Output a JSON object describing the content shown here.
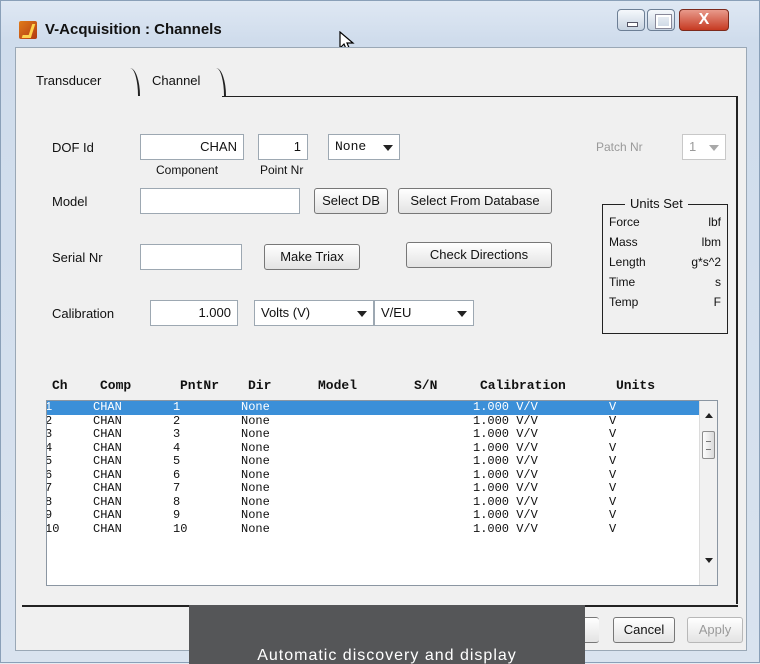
{
  "window": {
    "title": "V-Acquisition : Channels",
    "close_glyph": "X"
  },
  "tabs": [
    {
      "label": "Transducer"
    },
    {
      "label": "Channel"
    }
  ],
  "form": {
    "dof_id_label": "DOF Id",
    "component_value": "CHAN",
    "component_caption": "Component",
    "point_nr_value": "1",
    "point_nr_caption": "Point Nr",
    "direction_value": "None",
    "patch_nr_label": "Patch Nr",
    "patch_nr_value": "1",
    "model_label": "Model",
    "model_value": "",
    "select_db_label": "Select DB",
    "select_from_database_label": "Select From Database",
    "serial_nr_label": "Serial Nr",
    "serial_nr_value": "",
    "make_triax_label": "Make Triax",
    "check_directions_label": "Check Directions",
    "calibration_label": "Calibration",
    "calibration_value": "1.000",
    "volts_value": "Volts (V)",
    "veu_value": "V/EU"
  },
  "units_set": {
    "title": "Units Set",
    "rows": [
      {
        "name": "Force",
        "unit": "lbf"
      },
      {
        "name": "Mass",
        "unit": "lbm"
      },
      {
        "name": "Length",
        "unit": "g*s^2"
      },
      {
        "name": "Time",
        "unit": "s"
      },
      {
        "name": "Temp",
        "unit": "F"
      }
    ]
  },
  "table": {
    "headers": [
      "Ch",
      "Comp",
      "PntNr",
      "Dir",
      "Model",
      "S/N",
      "Calibration",
      "Units"
    ],
    "rows": [
      [
        "1",
        "CHAN",
        "1",
        "None",
        "",
        "",
        "1.000 V/V",
        "V"
      ],
      [
        "2",
        "CHAN",
        "2",
        "None",
        "",
        "",
        "1.000 V/V",
        "V"
      ],
      [
        "3",
        "CHAN",
        "3",
        "None",
        "",
        "",
        "1.000 V/V",
        "V"
      ],
      [
        "4",
        "CHAN",
        "4",
        "None",
        "",
        "",
        "1.000 V/V",
        "V"
      ],
      [
        "5",
        "CHAN",
        "5",
        "None",
        "",
        "",
        "1.000 V/V",
        "V"
      ],
      [
        "6",
        "CHAN",
        "6",
        "None",
        "",
        "",
        "1.000 V/V",
        "V"
      ],
      [
        "7",
        "CHAN",
        "7",
        "None",
        "",
        "",
        "1.000 V/V",
        "V"
      ],
      [
        "8",
        "CHAN",
        "8",
        "None",
        "",
        "",
        "1.000 V/V",
        "V"
      ],
      [
        "9",
        "CHAN",
        "9",
        "None",
        "",
        "",
        "1.000 V/V",
        "V"
      ],
      [
        "10",
        "CHAN",
        "10",
        "None",
        "",
        "",
        "1.000 V/V",
        "V"
      ]
    ],
    "selected_row": 0,
    "selection_color": "#3b8fd8"
  },
  "footer": {
    "cancel_label": "Cancel",
    "apply_label": "Apply"
  },
  "overlay": {
    "caption": "Automatic discovery and display"
  }
}
